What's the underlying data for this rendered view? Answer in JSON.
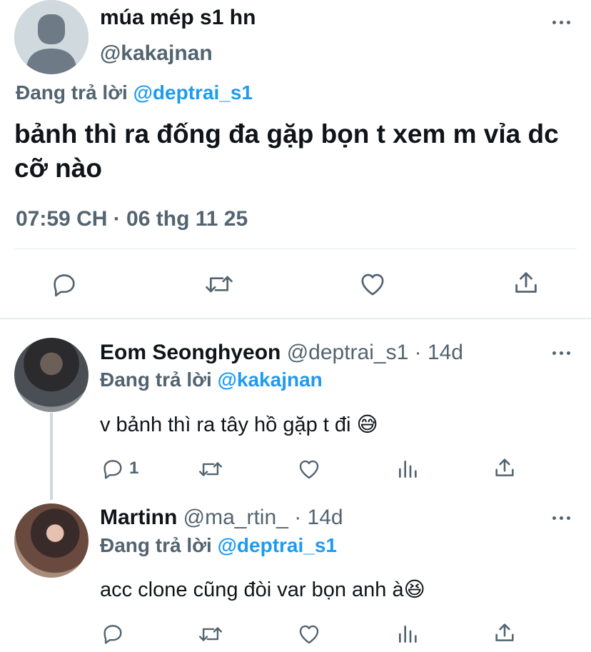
{
  "main_tweet": {
    "display_name": "múa mép s1 hn",
    "handle": "@kakajnan",
    "replying_prefix": "Đang trả lời",
    "replying_to": "@deptrai_s1",
    "text": "bảnh thì ra đống đa gặp bọn t xem m vỉa dc cỡ nào",
    "timestamp": "07:59 CH · 06 thg 11 25",
    "actions": [
      "reply-icon",
      "retweet-icon",
      "like-icon",
      "share-icon"
    ]
  },
  "replies": [
    {
      "display_name": "Eom Seonghyeon",
      "handle": "@deptrai_s1",
      "time": "· 14d",
      "replying_prefix": "Đang trả lời",
      "replying_to": "@kakajnan",
      "text": "v bảnh thì ra tây hồ gặp t đi",
      "emoji": "😅",
      "reply_count": "1"
    },
    {
      "display_name": "Martinn",
      "handle": "@ma_rtin_",
      "time": "· 14d",
      "replying_prefix": "Đang trả lời",
      "replying_to": "@deptrai_s1",
      "text": "acc clone cũng đòi var bọn anh à",
      "emoji": "😆",
      "reply_count": ""
    }
  ],
  "colors": {
    "accent": "#1d9bf0",
    "muted": "#536471",
    "text": "#0f1419",
    "divider": "#e6ecf0"
  }
}
